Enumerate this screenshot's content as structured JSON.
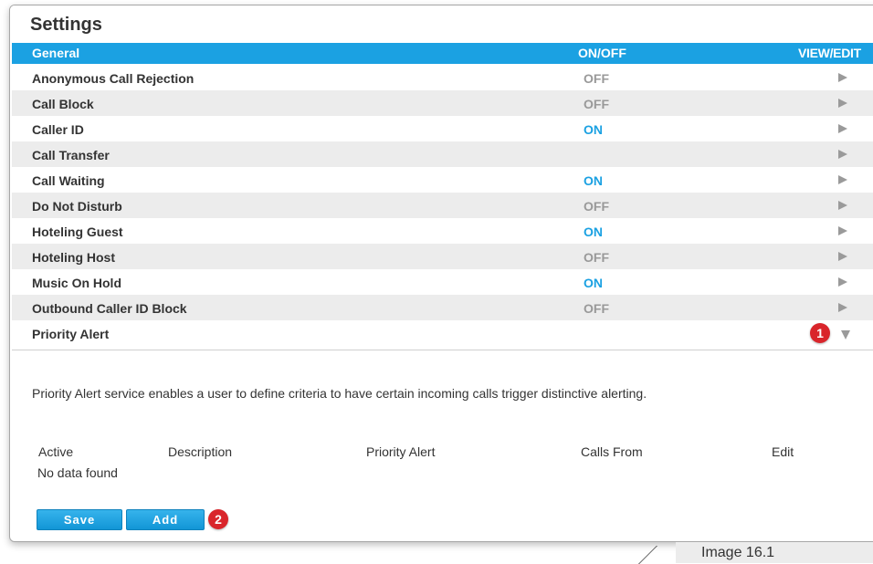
{
  "panel": {
    "title": "Settings"
  },
  "table": {
    "headers": {
      "name": "General",
      "state": "ON/OFF",
      "action": "VIEW/EDIT"
    },
    "rows": [
      {
        "name": "Anonymous Call Rejection",
        "state": "OFF"
      },
      {
        "name": "Call Block",
        "state": "OFF"
      },
      {
        "name": "Caller ID",
        "state": "ON"
      },
      {
        "name": "Call Transfer",
        "state": ""
      },
      {
        "name": "Call Waiting",
        "state": "ON"
      },
      {
        "name": "Do Not Disturb",
        "state": "OFF"
      },
      {
        "name": "Hoteling Guest",
        "state": "ON"
      },
      {
        "name": "Hoteling Host",
        "state": "OFF"
      },
      {
        "name": "Music On Hold",
        "state": "ON"
      },
      {
        "name": "Outbound Caller ID Block",
        "state": "OFF"
      },
      {
        "name": "Priority Alert",
        "state": ""
      }
    ]
  },
  "priority_alert": {
    "description": "Priority Alert service enables a user to define criteria to have certain incoming calls trigger distinctive alerting.",
    "columns": [
      "Active",
      "Description",
      "Priority Alert",
      "Calls From",
      "Edit"
    ],
    "empty_message": "No data found",
    "save_label": "Save",
    "add_label": "Add"
  },
  "markers": [
    "1",
    "2"
  ],
  "caption": "Image 16.1",
  "colors": {
    "accent": "#1ba1e2",
    "marker": "#d9252b",
    "off": "#999999"
  },
  "icons": {
    "row_expand": "play-arrow-icon",
    "row_collapse": "down-triangle-icon"
  }
}
